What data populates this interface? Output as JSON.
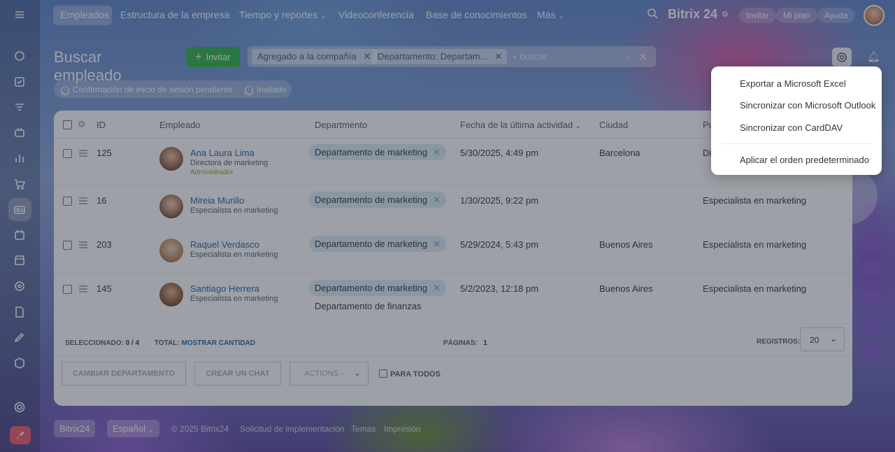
{
  "topnav": {
    "items": [
      "Empleados",
      "Estructura de la empresa",
      "Tiempo y reportes",
      "Videoconferencia",
      "Base de conocimientos",
      "Más"
    ],
    "brand": "Bitrix 24",
    "invite": "Invitar",
    "my_plan": "Mi plan",
    "help": "Ayuda"
  },
  "header": {
    "title": "Buscar empleado",
    "invite_button": "Invitar",
    "filters": [
      "Agregado a la compañía",
      "Departamento: Departam..."
    ],
    "search_placeholder": "+ buscar"
  },
  "counters": [
    {
      "count": "0",
      "label": "Confirmación de inicio de sesión pendiente"
    },
    {
      "count": "0",
      "label": "Invitado"
    }
  ],
  "table": {
    "columns": [
      "ID",
      "Empleado",
      "Departmento",
      "Fecha de la última actividad",
      "Ciudad",
      "Pu"
    ],
    "rows": [
      {
        "id": "125",
        "name": "Ana Laura Lima",
        "position": "Directora de marketing",
        "role": "Administrador",
        "depts": [
          "Departamento de marketing"
        ],
        "date": "5/30/2025, 4:49 pm",
        "city": "Barcelona",
        "job": "Di"
      },
      {
        "id": "16",
        "name": "Mireia Murillo",
        "position": "Especialista en marketing",
        "role": "",
        "depts": [
          "Departamento de marketing"
        ],
        "date": "1/30/2025, 9:22 pm",
        "city": "",
        "job": "Especialista en marketing"
      },
      {
        "id": "203",
        "name": "Raquel Verdasco",
        "position": "Especialista en marketing",
        "role": "",
        "depts": [
          "Departamento de marketing"
        ],
        "date": "5/29/2024, 5:43 pm",
        "city": "Buenos Aires",
        "job": "Especialista en marketing"
      },
      {
        "id": "145",
        "name": "Santiago Herrera",
        "position": "Especialista en marketing",
        "role": "",
        "depts": [
          "Departamento de marketing",
          "Departamento de finanzas"
        ],
        "date": "5/2/2023, 12:18 pm",
        "city": "Buenos Aires",
        "job": "Especialista en marketing"
      }
    ]
  },
  "grid_footer": {
    "selected_label": "SELECCIONADO:",
    "selected_value": "0 / 4",
    "total_label": "TOTAL:",
    "total_link": "MOSTRAR CANTIDAD",
    "pages_label": "PÁGINAS:",
    "pages_value": "1",
    "records_label": "REGISTROS:",
    "records_value": "20"
  },
  "actions": {
    "change_dept": "CAMBIAR DEPARTAMENTO",
    "create_chat": "CREAR UN CHAT",
    "actions_select": "- ACTIONS -",
    "for_all": "PARA TODOS"
  },
  "bottombar": {
    "brand": "Bitrix24",
    "language": "Español",
    "copyright": "© 2025 Bitrix24",
    "implementation": "Solicitud de implementación",
    "themes": "Temas",
    "print": "Impresión"
  },
  "settings_menu": {
    "items": [
      "Exportar a Microsoft Excel",
      "Sincronizar con Microsoft Outlook",
      "Sincronizar con CardDAV"
    ],
    "reset": "Aplicar el orden predeterminado"
  },
  "colors": {
    "accent_green": "#2fb54b",
    "link_blue": "#2067b0",
    "tag_bg": "#d9edf7",
    "admin_green": "#7ab517"
  }
}
